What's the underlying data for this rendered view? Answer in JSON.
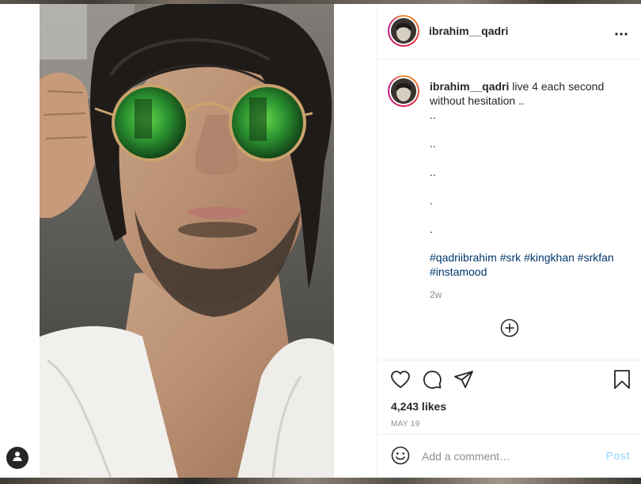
{
  "post": {
    "author": "ibrahim__qadri",
    "caption": {
      "username": "ibrahim__qadri",
      "text_line1": "live 4 each second",
      "text_line2": "without hesitation ..",
      "dot_lines": [
        "..",
        "..",
        "..",
        ".",
        "."
      ]
    },
    "hashtags": [
      "#qadriibrahim",
      "#srk",
      "#kingkhan",
      "#srkfan",
      "#instamood"
    ],
    "time_ago": "2w",
    "likes": "4,243 likes",
    "date": "MAY 19"
  },
  "comment_box": {
    "placeholder": "Add a comment…",
    "post_label": "Post"
  },
  "icons": {
    "more": "more-options-icon",
    "load_more": "add-circle-icon",
    "like": "heart-icon",
    "comment": "comment-icon",
    "share": "paper-plane-icon",
    "save": "bookmark-icon",
    "emoji": "smiley-icon",
    "account": "user-icon"
  },
  "colors": {
    "link": "#00376b",
    "muted": "#8e8e8e",
    "post_disabled": "#b2dffc",
    "text": "#262626"
  }
}
